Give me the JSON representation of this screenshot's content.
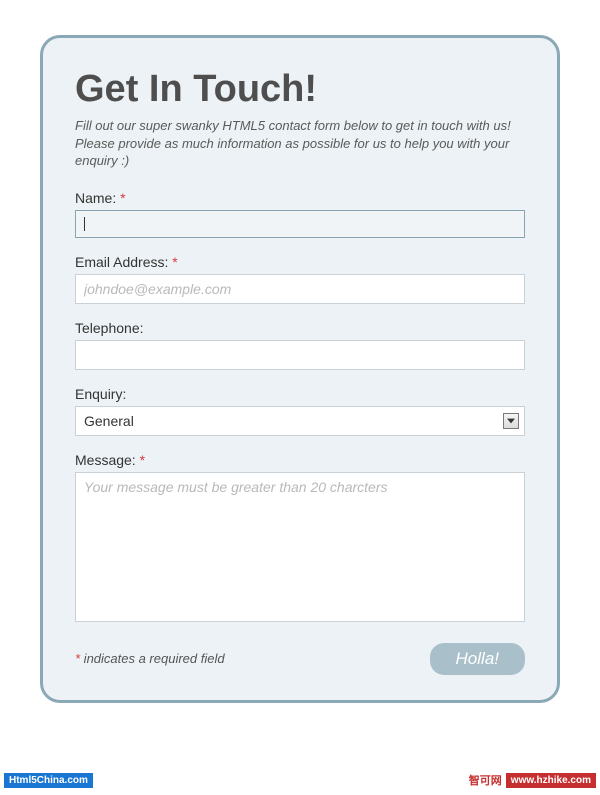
{
  "title": "Get In Touch!",
  "subtitle": "Fill out our super swanky HTML5 contact form below to get in touch with us! Please provide as much information as possible for us to help you with your enquiry :)",
  "fields": {
    "name": {
      "label": "Name:",
      "required": true,
      "value": ""
    },
    "email": {
      "label": "Email Address:",
      "required": true,
      "placeholder": "johndoe@example.com",
      "value": ""
    },
    "telephone": {
      "label": "Telephone:",
      "required": false,
      "value": ""
    },
    "enquiry": {
      "label": "Enquiry:",
      "required": false,
      "selected": "General"
    },
    "message": {
      "label": "Message:",
      "required": true,
      "placeholder": "Your message must be greater than 20 charcters",
      "value": ""
    }
  },
  "required_marker": "*",
  "required_note_prefix": "*",
  "required_note_text": " indicates a required field",
  "submit_label": "Holla!",
  "badge_left": "Html5China.com",
  "badge_right_cn": "智可网",
  "badge_right_url": "www.hzhike.com"
}
